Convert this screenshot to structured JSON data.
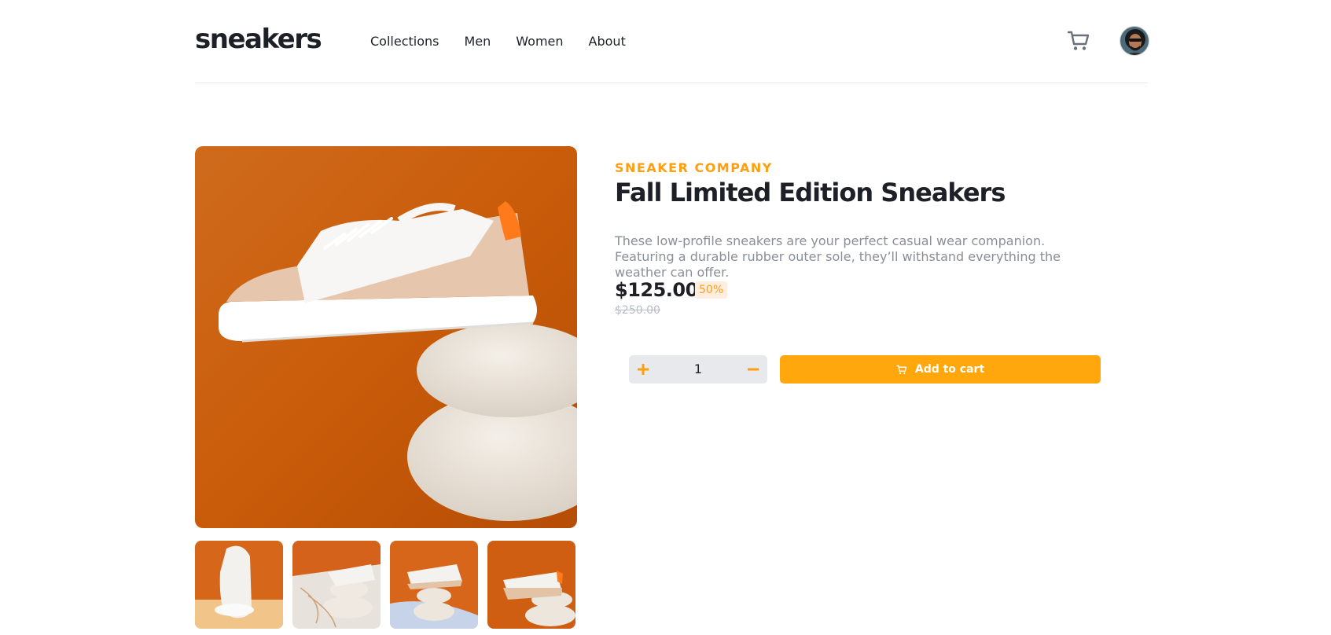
{
  "brand": {
    "logo": "sneakers"
  },
  "nav": {
    "items": [
      "Collections",
      "Men",
      "Women",
      "About"
    ]
  },
  "header_icons": {
    "cart": "cart-icon",
    "avatar": "avatar"
  },
  "product": {
    "company": "SNEAKER COMPANY",
    "title": "Fall Limited Edition Sneakers",
    "description": "These low-profile sneakers are your perfect casual wear companion. Featuring a durable rubber outer sole, they’ll withstand everything the weather can offer.",
    "price": "$125.00",
    "discount": "50%",
    "original_price": "$250.00"
  },
  "quantity": {
    "value": "1",
    "plus_icon": "plus-icon",
    "minus_icon": "minus-icon"
  },
  "cart_button": {
    "label": "Add to cart",
    "icon": "cart-icon"
  },
  "colors": {
    "accent": "#ff9f0f",
    "button": "#ffa70d",
    "text": "#1d2026",
    "muted": "#8a8e96",
    "discount_bg": "#ffede0",
    "photo_bg": "#d2620f"
  }
}
